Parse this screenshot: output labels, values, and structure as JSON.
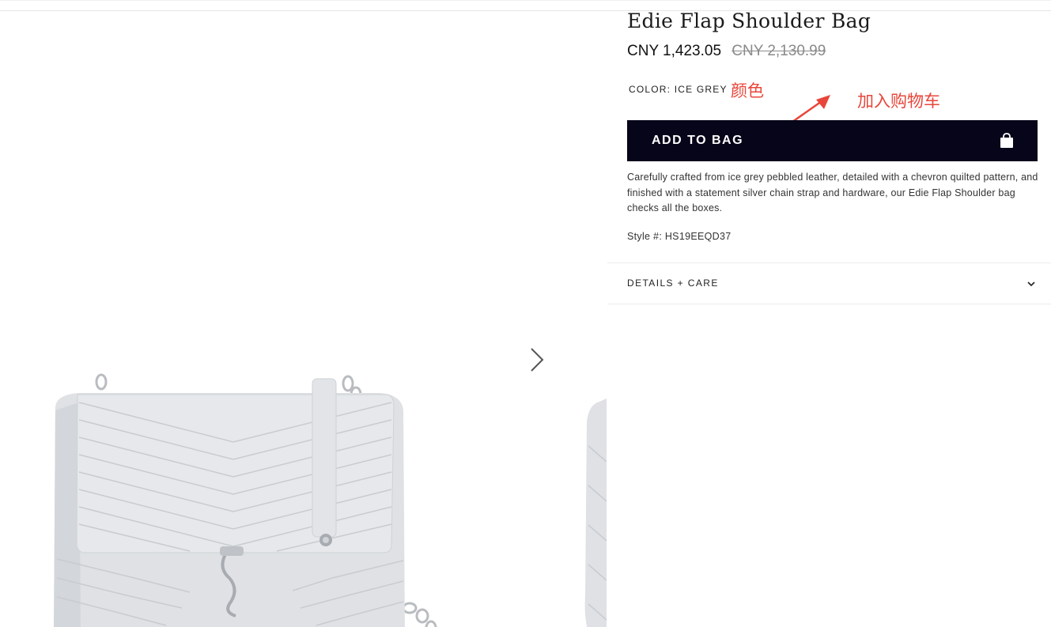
{
  "product": {
    "title": "Edie Flap Shoulder Bag",
    "price_current": "CNY 1,423.05",
    "price_original": "CNY 2,130.99",
    "color_label": "COLOR: ICE GREY",
    "add_to_bag_label": "ADD TO BAG",
    "description": "Carefully crafted from ice grey pebbled leather, detailed with a chevron quilted pattern, and finished with a statement silver chain strap and hardware, our Edie Flap Shoulder bag checks all the boxes.",
    "style_number": "Style #: HS19EEQD37",
    "details_label": "DETAILS + CARE"
  },
  "annotations": {
    "color_note": "颜色",
    "cart_note": "加入购物车",
    "color": "#e8463a"
  },
  "gallery": {
    "next_icon": "chevron-right-icon",
    "bag_color": "#dfe1e4"
  },
  "colors": {
    "button_bg": "#06051a",
    "button_text": "#ffffff"
  }
}
